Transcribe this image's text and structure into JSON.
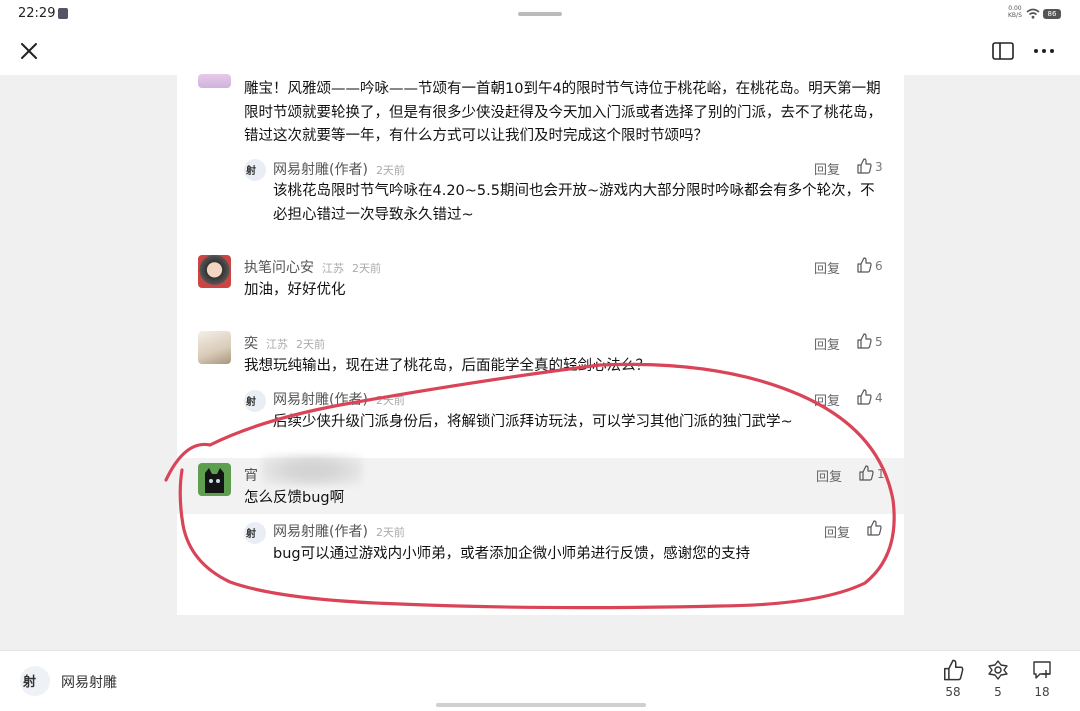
{
  "status_bar": {
    "time": "22:29",
    "net_speed": "0.00",
    "net_unit": "KB/S",
    "battery": "86"
  },
  "comments": [
    {
      "text": "雕宝！风雅颂——吟咏——节颂有一首朝10到午4的限时节气诗位于桃花峪，在桃花岛。明天第一期限时节颂就要轮换了，但是有很多少侠没赶得及今天加入门派或者选择了别的门派，去不了桃花岛，错过这次就要等一年，有什么方式可以让我们及时完成这个限时节颂吗？",
      "reply": {
        "author": "网易射雕(作者)",
        "time": "2天前",
        "reply_label": "回复",
        "likes": "3",
        "text": "该桃花岛限时节气吟咏在4.20~5.5期间也会开放~游戏内大部分限时吟咏都会有多个轮次，不必担心错过一次导致永久错过~"
      }
    },
    {
      "author": "执笔问心安",
      "location": "江苏",
      "time": "2天前",
      "reply_label": "回复",
      "likes": "6",
      "text": "加油，好好优化"
    },
    {
      "author": "奕",
      "location": "江苏",
      "time": "2天前",
      "reply_label": "回复",
      "likes": "5",
      "text": "我想玩纯输出，现在进了桃花岛，后面能学全真的轻剑心法么？",
      "reply": {
        "author": "网易射雕(作者)",
        "time": "2天前",
        "reply_label": "回复",
        "likes": "4",
        "text": "后续少侠升级门派身份后，将解锁门派拜访玩法，可以学习其他门派的独门武学~"
      }
    },
    {
      "author": "宵",
      "reply_label": "回复",
      "likes": "1",
      "text": "怎么反馈bug啊",
      "reply": {
        "author": "网易射雕(作者)",
        "time": "2天前",
        "reply_label": "回复",
        "text": "bug可以通过游戏内小师弟，或者添加企微小师弟进行反馈，感谢您的支持"
      }
    }
  ],
  "bottom_bar": {
    "account_name": "网易射雕",
    "likes": "58",
    "shares": "5",
    "comments": "18"
  },
  "colors": {
    "annotation": "#d94458",
    "accent": "#333333"
  }
}
